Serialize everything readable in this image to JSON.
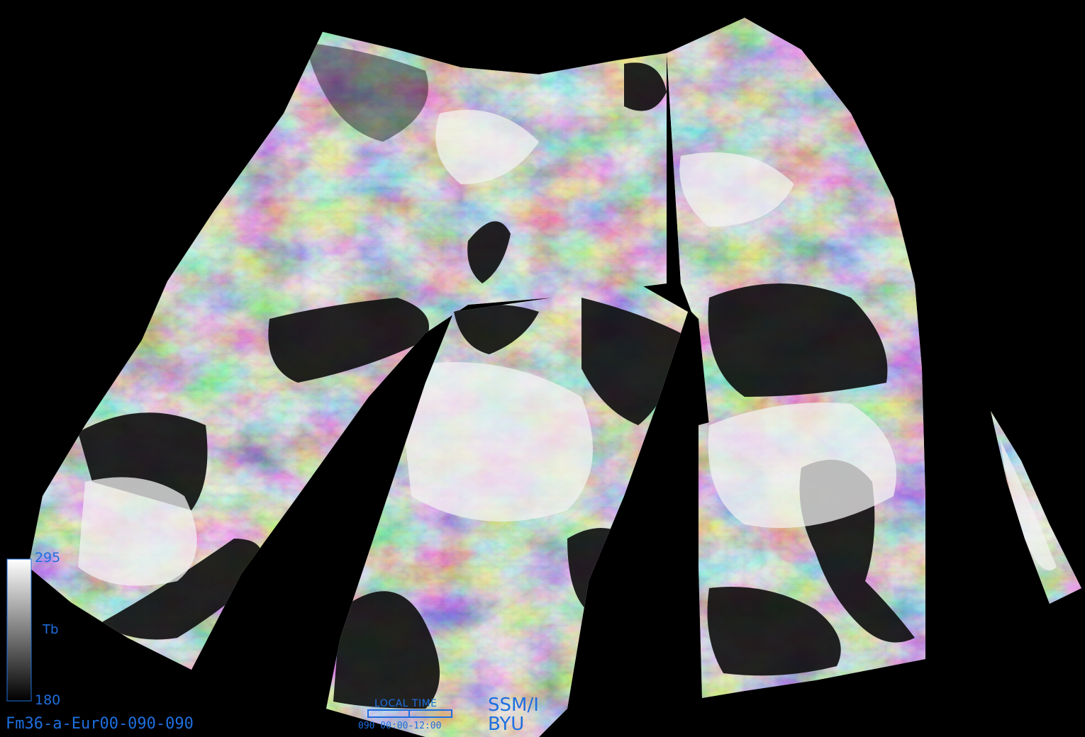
{
  "product": {
    "id": "Fm36-a-Eur00-090-090",
    "sensor": "SSM/I",
    "institution": "BYU"
  },
  "colorbar": {
    "max": "295",
    "min": "180",
    "quantity": "Tb",
    "colors": {
      "high": "#ffffff",
      "low": "#000000"
    }
  },
  "local_time": {
    "label": "LOCAL TIME",
    "range": "090 00:00-12:00",
    "fill_fraction": 0.5
  },
  "theme": {
    "background": "#000000",
    "annotation_color": "#1e6fe0"
  }
}
